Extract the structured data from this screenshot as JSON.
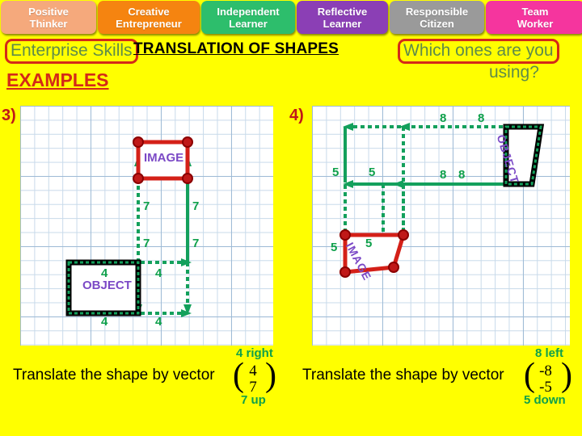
{
  "tabs": [
    {
      "line1": "Positive",
      "line2": "Thinker",
      "color": "#F5A97C",
      "width": "118"
    },
    {
      "line1": "Creative",
      "line2": "Entrepreneur",
      "color": "#F58410",
      "width": "126"
    },
    {
      "line1": "Independent",
      "line2": "Learner",
      "color": "#2DBE6C",
      "width": "116"
    },
    {
      "line1": "Reflective",
      "line2": "Learner",
      "color": "#8B3FB5",
      "width": "113"
    },
    {
      "line1": "Responsible",
      "line2": "Citizen",
      "color": "#9A9A9A",
      "width": "117"
    },
    {
      "line1": "Team",
      "line2": "Worker",
      "color": "#F5359E",
      "width": "122"
    }
  ],
  "header": {
    "enterprise_skills": "Enterprise Skills",
    "title": "TRANSLATION OF SHAPES",
    "which_line1": "Which ones are you",
    "which_line2": "using?",
    "examples": "EXAMPLES"
  },
  "diagram3": {
    "number": "3)",
    "object_label": "OBJECT",
    "image_label": "IMAGE",
    "dims": {
      "vertical_left_upper": "7",
      "vertical_right_upper": "7",
      "vertical_left_lower": "7",
      "vertical_right_lower": "7",
      "horiz_top_left": "4",
      "horiz_top_right": "4",
      "horiz_bottom_left": "4",
      "horiz_bottom_right": "4"
    },
    "vector": {
      "sentence": "Translate the shape by vector",
      "x": "4",
      "y": "7",
      "x_words": "4 right",
      "y_words": "7 up"
    }
  },
  "diagram4": {
    "number": "4)",
    "object_label": "OBJECT",
    "image_label": "IMAGE",
    "dims": {
      "horiz_top_left": "8",
      "horiz_top_right": "8",
      "horiz_mid_left": "8",
      "horiz_mid_right": "8",
      "vert_left": "5",
      "vert_right": "5",
      "vert_lower_left": "5",
      "vert_lower_right": "5"
    },
    "vector": {
      "sentence": "Translate the shape by vector",
      "x": "-8",
      "y": "-5",
      "x_words": "8 left",
      "y_words": "5 down"
    }
  },
  "colors": {
    "background": "#FFFF00",
    "accent_red": "#D42A18",
    "image_red": "#D42018",
    "arrow_green": "#13A05C",
    "label_purple": "#7B49C6",
    "grid_blue": "#9FBBD6"
  }
}
